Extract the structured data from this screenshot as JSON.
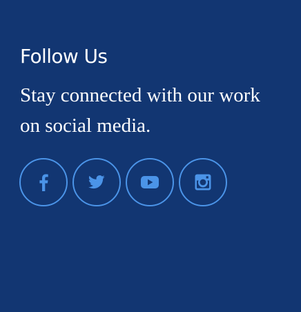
{
  "follow_section": {
    "heading": "Follow Us",
    "tagline": "Stay connected with our work on social media.",
    "colors": {
      "background": "#123672",
      "text": "#ffffff",
      "icon_accent": "#4b94e8"
    },
    "social_links": [
      {
        "icon": "facebook-icon"
      },
      {
        "icon": "twitter-icon"
      },
      {
        "icon": "youtube-icon"
      },
      {
        "icon": "instagram-icon"
      }
    ]
  }
}
